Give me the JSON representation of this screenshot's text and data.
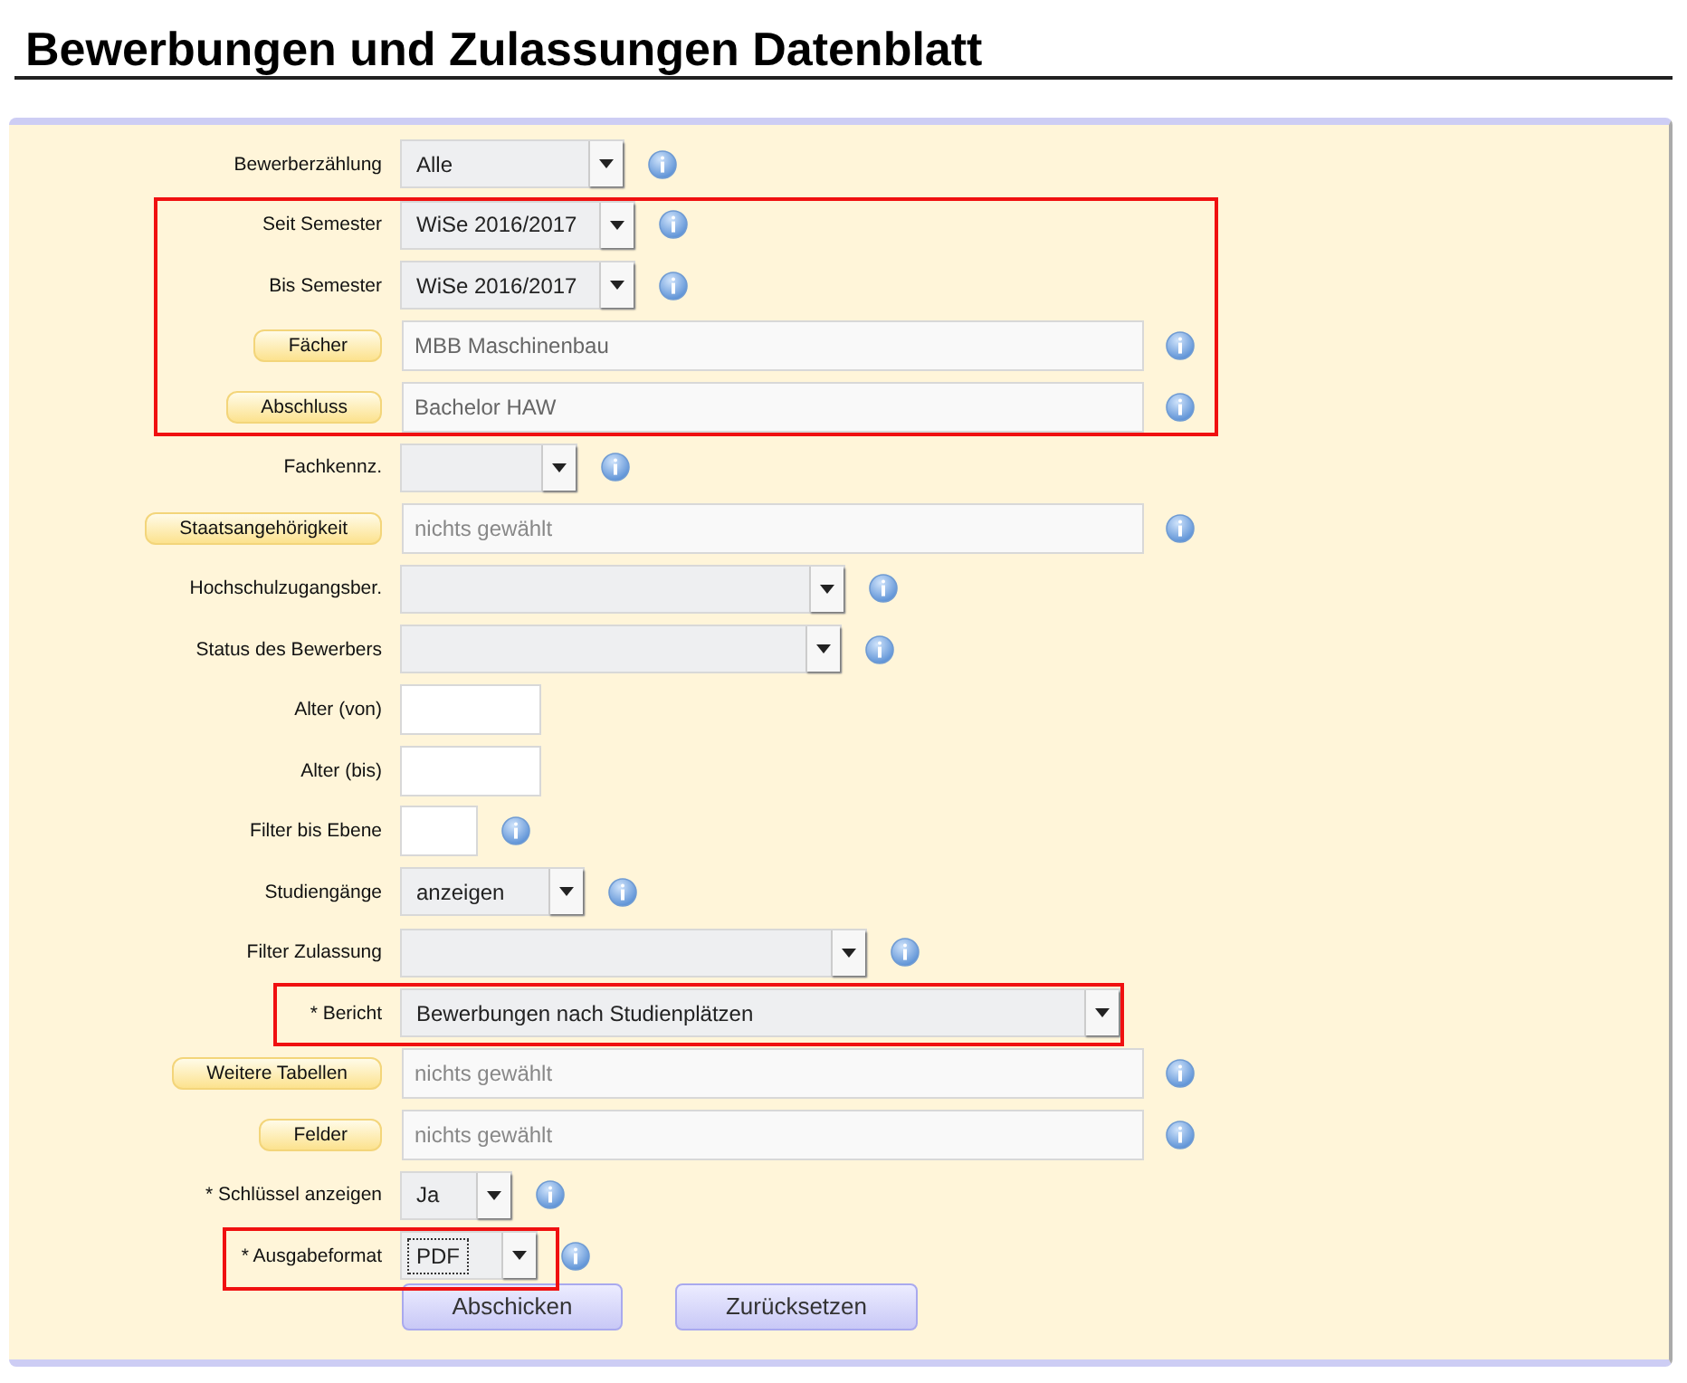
{
  "title": "Bewerbungen und Zulassungen Datenblatt",
  "sections": [
    {
      "highlighted": false,
      "rows": [
        {
          "kind": "select",
          "label": "Bewerberzählung",
          "value": "Alle",
          "info": true,
          "focused": false
        }
      ]
    },
    {
      "highlighted": true,
      "rows": [
        {
          "kind": "select",
          "label": "Seit Semester",
          "value": "WiSe 2016/2017",
          "info": true,
          "focused": false
        },
        {
          "kind": "select",
          "label": "Bis Semester",
          "value": "WiSe 2016/2017",
          "info": true,
          "focused": false
        },
        {
          "kind": "picker",
          "label": "Fächer",
          "value": "MBB Maschinenbau",
          "info": true,
          "focused": false
        },
        {
          "kind": "picker",
          "label": "Abschluss",
          "value": "Bachelor HAW",
          "info": true,
          "focused": false
        }
      ]
    },
    {
      "highlighted": false,
      "rows": [
        {
          "kind": "select",
          "label": "Fachkennz.",
          "info": true,
          "focused": false
        },
        {
          "kind": "picker",
          "label": "Staatsangehörigkeit",
          "placeholder": "nichts gewählt",
          "info": true,
          "focused": false
        },
        {
          "kind": "select",
          "label": "Hochschulzugangsber.",
          "info": true,
          "focused": false
        },
        {
          "kind": "select",
          "label": "Status des Bewerbers",
          "info": true,
          "focused": false
        },
        {
          "kind": "input",
          "label": "Alter (von)",
          "info": false,
          "focused": false
        },
        {
          "kind": "input",
          "label": "Alter (bis)",
          "info": false,
          "focused": false
        },
        {
          "kind": "input",
          "label": "Filter bis Ebene",
          "info": true,
          "focused": false
        },
        {
          "kind": "select",
          "label": "Studiengänge",
          "value": "anzeigen",
          "info": true,
          "focused": false
        },
        {
          "kind": "select",
          "label": "Filter Zulassung",
          "info": true,
          "focused": false
        }
      ]
    },
    {
      "highlighted": true,
      "rows": [
        {
          "kind": "select",
          "label": "* Bericht",
          "value": "Bewerbungen nach Studienplätzen",
          "info": false,
          "focused": false
        }
      ]
    },
    {
      "highlighted": false,
      "rows": [
        {
          "kind": "picker",
          "label": "Weitere Tabellen",
          "placeholder": "nichts gewählt",
          "info": true,
          "focused": false
        },
        {
          "kind": "picker",
          "label": "Felder",
          "placeholder": "nichts gewählt",
          "info": true,
          "focused": false
        },
        {
          "kind": "select",
          "label": "* Schlüssel anzeigen",
          "value": "Ja",
          "info": true,
          "focused": false
        }
      ]
    },
    {
      "highlighted": true,
      "rows": [
        {
          "kind": "select",
          "label": "* Ausgabeformat",
          "value": "PDF",
          "info": true,
          "focused": true
        }
      ]
    }
  ],
  "buttons": [
    "Abschicken",
    "Zurücksetzen"
  ]
}
